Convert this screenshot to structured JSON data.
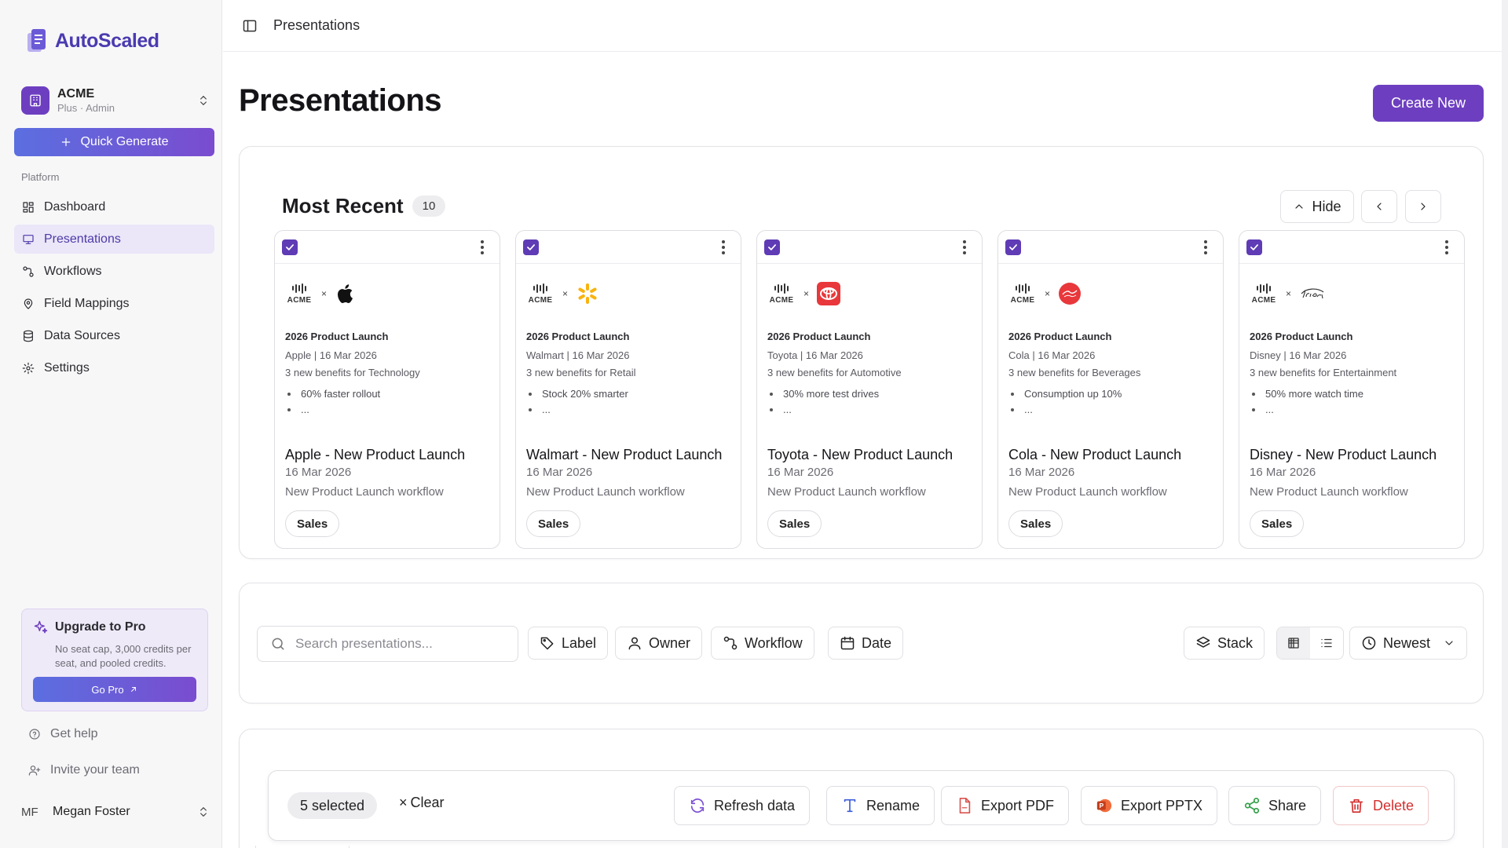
{
  "app": {
    "name": "AutoScaled"
  },
  "org": {
    "name": "ACME",
    "plan": "Plus · Admin"
  },
  "sidebar": {
    "quick_generate": "Quick Generate",
    "section_label": "Platform",
    "items": [
      {
        "label": "Dashboard",
        "icon": "grid-icon"
      },
      {
        "label": "Presentations",
        "icon": "presentation-icon"
      },
      {
        "label": "Workflows",
        "icon": "workflow-icon"
      },
      {
        "label": "Field Mappings",
        "icon": "map-pin-icon"
      },
      {
        "label": "Data Sources",
        "icon": "database-icon"
      },
      {
        "label": "Settings",
        "icon": "gear-icon"
      }
    ],
    "active_index": 1,
    "upgrade": {
      "title": "Upgrade to Pro",
      "description": "No seat cap, 3,000 credits per seat, and pooled credits.",
      "button": "Go Pro"
    },
    "get_help": "Get help",
    "invite": "Invite your team",
    "user": {
      "initials": "MF",
      "name": "Megan Foster"
    }
  },
  "topbar": {
    "title": "Presentations"
  },
  "page": {
    "title": "Presentations",
    "create_new": "Create New"
  },
  "recent": {
    "title": "Most Recent",
    "count": "10",
    "hide_label": "Hide",
    "cards": [
      {
        "slide_title": "2026 Product Launch",
        "slide_meta": "Apple | 16 Mar 2026",
        "slide_benefits": "3 new benefits for Technology",
        "bullet1": "60% faster rollout",
        "bullet2": "...",
        "title": "Apple - New Product Launch",
        "date": "16 Mar 2026",
        "workflow": "New Product Launch workflow",
        "tag": "Sales",
        "brand": "apple-logo-icon"
      },
      {
        "slide_title": "2026 Product Launch",
        "slide_meta": "Walmart | 16 Mar 2026",
        "slide_benefits": "3 new benefits for Retail",
        "bullet1": "Stock 20% smarter",
        "bullet2": "...",
        "title": "Walmart - New Product Launch",
        "date": "16 Mar 2026",
        "workflow": "New Product Launch workflow",
        "tag": "Sales",
        "brand": "walmart-spark-icon"
      },
      {
        "slide_title": "2026 Product Launch",
        "slide_meta": "Toyota | 16 Mar 2026",
        "slide_benefits": "3 new benefits for Automotive",
        "bullet1": "30% more test drives",
        "bullet2": "...",
        "title": "Toyota - New Product Launch",
        "date": "16 Mar 2026",
        "workflow": "New Product Launch workflow",
        "tag": "Sales",
        "brand": "toyota-logo-icon"
      },
      {
        "slide_title": "2026 Product Launch",
        "slide_meta": "Cola | 16 Mar 2026",
        "slide_benefits": "3 new benefits for Beverages",
        "bullet1": "Consumption up 10%",
        "bullet2": "...",
        "title": "Cola - New Product Launch",
        "date": "16 Mar 2026",
        "workflow": "New Product Launch workflow",
        "tag": "Sales",
        "brand": "cola-logo-icon"
      },
      {
        "slide_title": "2026 Product Launch",
        "slide_meta": "Disney | 16 Mar 2026",
        "slide_benefits": "3 new benefits for Entertainment",
        "bullet1": "50% more watch time",
        "bullet2": "...",
        "title": "Disney - New Product Launch",
        "date": "16 Mar 2026",
        "workflow": "New Product Launch workflow",
        "tag": "Sales",
        "brand": "disney-logo-icon"
      }
    ],
    "acme_label": "ACME",
    "times": "×"
  },
  "filters": {
    "search_placeholder": "Search presentations...",
    "label": "Label",
    "owner": "Owner",
    "workflow": "Workflow",
    "date": "Date",
    "stack": "Stack",
    "sort": "Newest"
  },
  "selection": {
    "count": "5 selected",
    "clear": "Clear",
    "clear_x": "×",
    "refresh": "Refresh data",
    "rename": "Rename",
    "export_pdf": "Export PDF",
    "export_pptx": "Export PPTX",
    "share": "Share",
    "delete": "Delete"
  },
  "colors": {
    "primary": "#6d3fc0",
    "danger": "#d32f2f",
    "active_nav_bg": "#ebe6f8"
  }
}
